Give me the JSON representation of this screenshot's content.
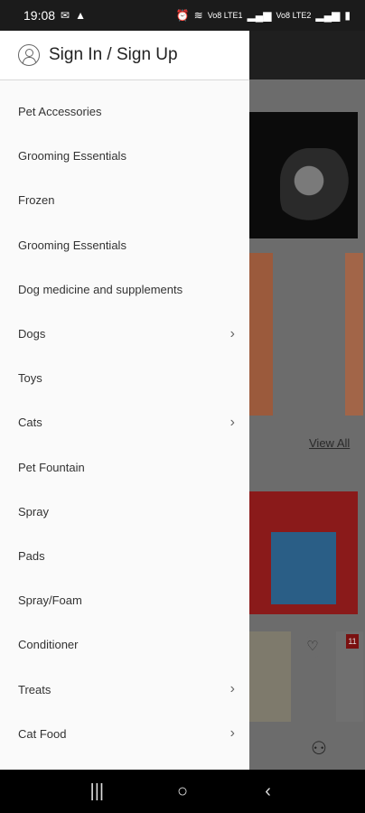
{
  "status_bar": {
    "time": "19:08",
    "left_icons": [
      "email-icon",
      "warning-icon"
    ],
    "right_icons": [
      "alarm-icon",
      "wifi-icon",
      "signal-icon",
      "battery-icon"
    ],
    "net_label_1": "Vo8 LTE1",
    "net_label_2": "Vo8 LTE2"
  },
  "background": {
    "view_all": "View All",
    "badge": "11",
    "heart": "♡",
    "user": "user-icon"
  },
  "drawer": {
    "sign_in_label": "Sign In / Sign Up",
    "items": [
      {
        "label": "Pet Accessories",
        "chevron": false
      },
      {
        "label": "Grooming Essentials",
        "chevron": false
      },
      {
        "label": "Frozen",
        "chevron": false
      },
      {
        "label": "Grooming Essentials",
        "chevron": false
      },
      {
        "label": "Dog medicine and supplements",
        "chevron": false
      },
      {
        "label": "Dogs",
        "chevron": true
      },
      {
        "label": "Toys",
        "chevron": false
      },
      {
        "label": "Cats",
        "chevron": true
      },
      {
        "label": "Pet Fountain",
        "chevron": false
      },
      {
        "label": "Spray",
        "chevron": false
      },
      {
        "label": "Pads",
        "chevron": false
      },
      {
        "label": "Spray/Foam",
        "chevron": false
      },
      {
        "label": "Conditioner",
        "chevron": false
      },
      {
        "label": "Treats",
        "chevron": true
      },
      {
        "label": "Cat Food",
        "chevron": true
      }
    ]
  },
  "nav_bar": {
    "recents": "|||",
    "home": "○",
    "back": "‹"
  },
  "colors": {
    "drawer_bg": "#fafafa",
    "scrim": "#6c6c6c",
    "status_bar": "#1b1b1b"
  }
}
